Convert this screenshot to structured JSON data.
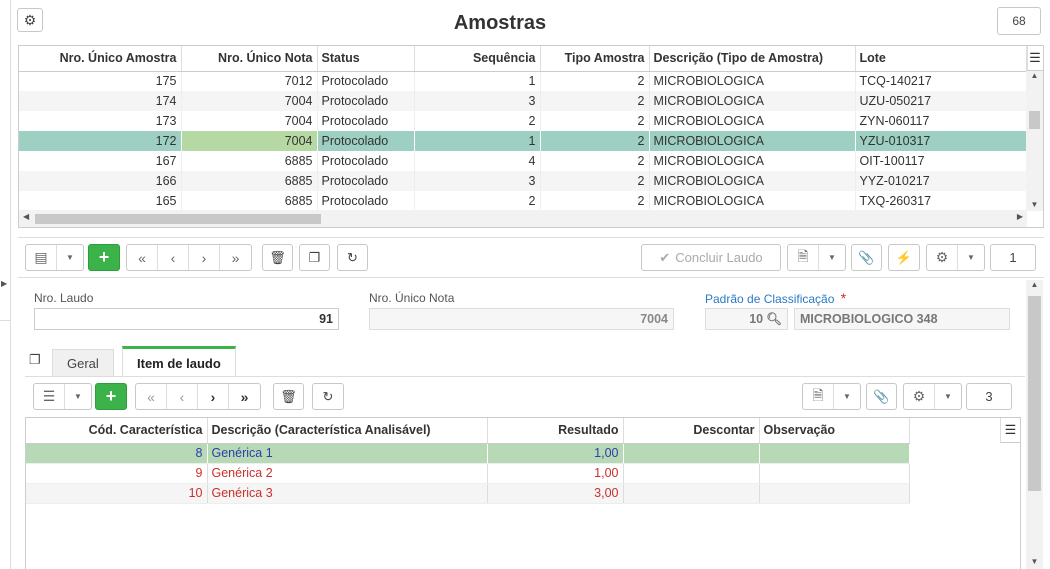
{
  "header": {
    "title": "Amostras",
    "count": "68"
  },
  "grid1": {
    "columns": [
      "Nro. Único Amostra",
      "Nro. Único Nota",
      "Status",
      "Sequência",
      "Tipo Amostra",
      "Descrição (Tipo de Amostra)",
      "Lote"
    ],
    "rows": [
      [
        "175",
        "7012",
        "Protocolado",
        "1",
        "2",
        "MICROBIOLOGICA",
        "TCQ-140217"
      ],
      [
        "174",
        "7004",
        "Protocolado",
        "3",
        "2",
        "MICROBIOLOGICA",
        "UZU-050217"
      ],
      [
        "173",
        "7004",
        "Protocolado",
        "2",
        "2",
        "MICROBIOLOGICA",
        "ZYN-060117"
      ],
      [
        "172",
        "7004",
        "Protocolado",
        "1",
        "2",
        "MICROBIOLOGICA",
        "YZU-010317"
      ],
      [
        "167",
        "6885",
        "Protocolado",
        "4",
        "2",
        "MICROBIOLOGICA",
        "OIT-100117"
      ],
      [
        "166",
        "6885",
        "Protocolado",
        "3",
        "2",
        "MICROBIOLOGICA",
        "YYZ-010217"
      ],
      [
        "165",
        "6885",
        "Protocolado",
        "2",
        "2",
        "MICROBIOLOGICA",
        "TXQ-260317"
      ]
    ],
    "selected_index": 3
  },
  "toolbar": {
    "concluir_label": "Concluir Laudo",
    "page": "1"
  },
  "form": {
    "nro_laudo_label": "Nro. Laudo",
    "nro_laudo_value": "91",
    "nro_nota_label": "Nro. Único Nota",
    "nro_nota_value": "7004",
    "padrao_label": "Padrão de Classificação",
    "required_mark": "*",
    "padrao_code": "10",
    "padrao_desc": "MICROBIOLOGICO 348"
  },
  "tabs": [
    {
      "label": "Geral"
    },
    {
      "label": "Item de laudo"
    }
  ],
  "subtoolbar": {
    "count": "3"
  },
  "grid2": {
    "columns": [
      "Cód. Característica",
      "Descrição (Característica Analisável)",
      "Resultado",
      "Descontar",
      "Observação"
    ],
    "rows": [
      [
        "8",
        "Genérica 1",
        "1,00",
        "",
        ""
      ],
      [
        "9",
        "Genérica 2",
        "1,00",
        "",
        ""
      ],
      [
        "10",
        "Genérica 3",
        "3,00",
        "",
        ""
      ]
    ]
  },
  "colors": {
    "accent_green": "#3cb34a",
    "selected_row": "#9dcfc3",
    "link_blue": "#2a7ac6",
    "error_red": "#c9302c"
  }
}
